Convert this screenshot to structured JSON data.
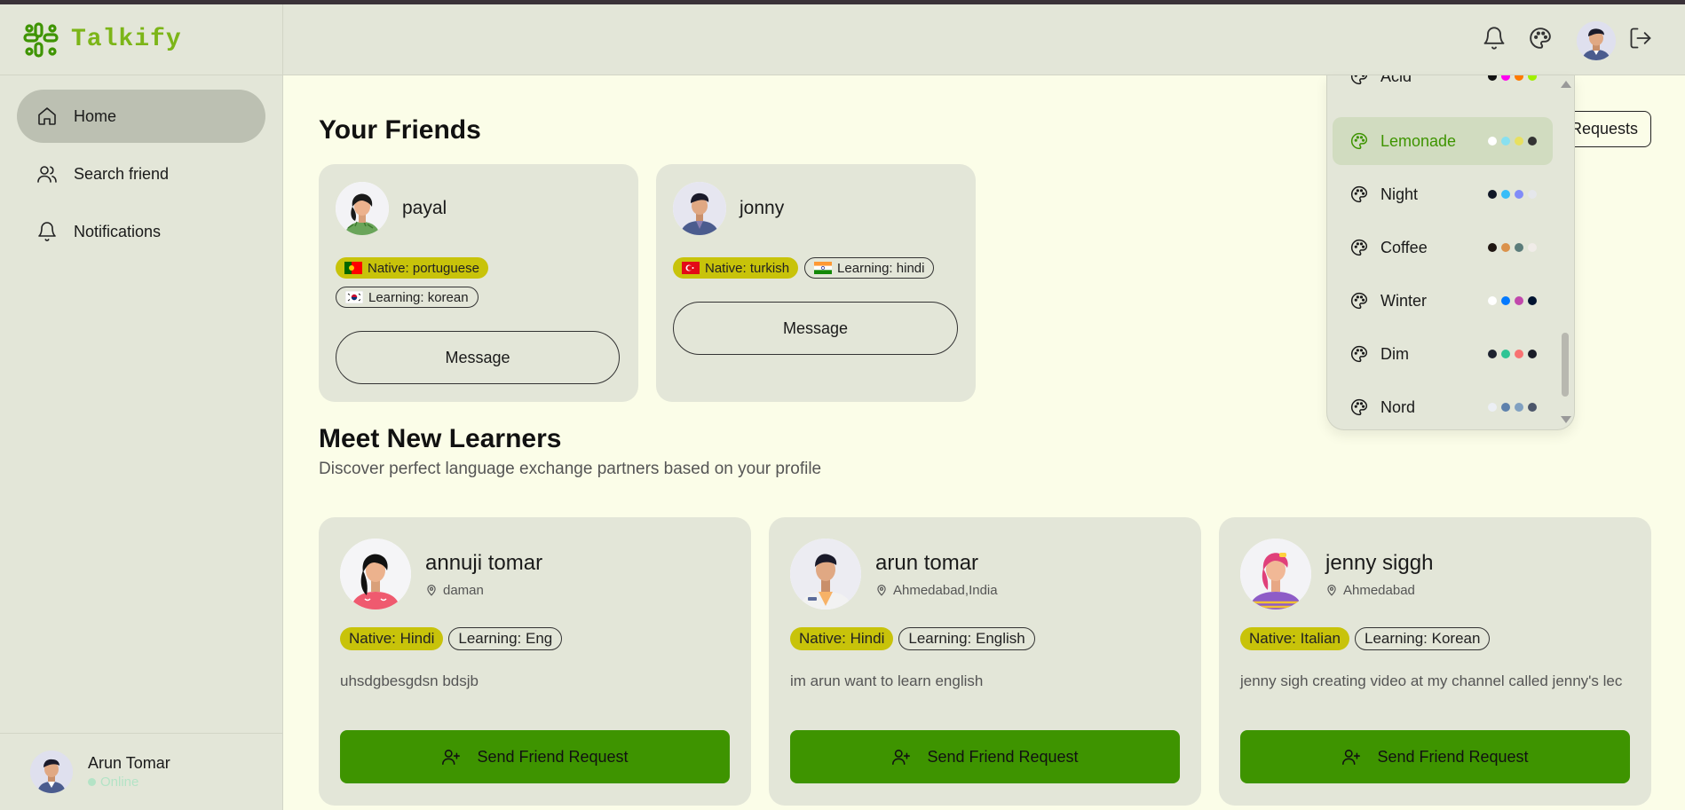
{
  "app": {
    "brand": "Talkify"
  },
  "colors": {
    "brand": "#7cb518",
    "accent_green": "#3e9400",
    "native_chip": "#c8c30a",
    "sidebar_bg": "#e3e6d8",
    "page_bg": "#fbfde8"
  },
  "sidebar": {
    "items": [
      {
        "label": "Home",
        "icon": "home-icon",
        "active": true
      },
      {
        "label": "Search friend",
        "icon": "users-icon",
        "active": false
      },
      {
        "label": "Notifications",
        "icon": "bell-icon",
        "active": false
      }
    ],
    "user": {
      "name": "Arun Tomar",
      "status": "Online"
    }
  },
  "topbar": {
    "icons": [
      "bell-icon",
      "palette-icon",
      "avatar",
      "logout-icon"
    ]
  },
  "friends": {
    "title": "Your Friends",
    "requests_label": "Requests",
    "cards": [
      {
        "name": "payal",
        "native": "Native: portuguese",
        "learning": "Learning: korean",
        "native_flag": "portugal-flag",
        "learning_flag": "korea-flag",
        "button": "Message"
      },
      {
        "name": "jonny",
        "native": "Native: turkish",
        "learning": "Learning: hindi",
        "native_flag": "turkey-flag",
        "learning_flag": "india-flag",
        "button": "Message"
      }
    ]
  },
  "learners": {
    "title": "Meet New Learners",
    "subtitle": "Discover perfect language exchange partners based on your profile",
    "cards": [
      {
        "name": "annuji tomar",
        "location": "daman",
        "native": "Native: Hindi",
        "learning": "Learning: Eng",
        "bio": "uhsdgbesgdsn bdsjb",
        "button": "Send Friend Request"
      },
      {
        "name": "arun tomar",
        "location": "Ahmedabad,India",
        "native": "Native: Hindi",
        "learning": "Learning: English",
        "bio": "im arun want to learn english",
        "button": "Send Friend Request"
      },
      {
        "name": "jenny siggh",
        "location": "Ahmedabad",
        "native": "Native: Italian",
        "learning": "Learning: Korean",
        "bio": "jenny sigh creating video at my channel called jenny's lec",
        "button": "Send Friend Request"
      }
    ]
  },
  "themes": {
    "items": [
      {
        "name": "Acid",
        "active": false,
        "dots": [
          "#111111",
          "#ff00f0",
          "#ff7a00",
          "#a0f000"
        ]
      },
      {
        "name": "Lemonade",
        "active": true,
        "dots": [
          "#ffffff",
          "#88e0f0",
          "#e8e060",
          "#333333"
        ]
      },
      {
        "name": "Night",
        "active": false,
        "dots": [
          "#111827",
          "#38bdf8",
          "#818cf8",
          "#e5e7eb"
        ]
      },
      {
        "name": "Coffee",
        "active": false,
        "dots": [
          "#1f1612",
          "#db924b",
          "#5b7c7a",
          "#f0ece8"
        ]
      },
      {
        "name": "Winter",
        "active": false,
        "dots": [
          "#ffffff",
          "#047aff",
          "#c148ac",
          "#021431"
        ]
      },
      {
        "name": "Dim",
        "active": false,
        "dots": [
          "#1e2330",
          "#2fc495",
          "#f87272",
          "#1a1d28"
        ]
      },
      {
        "name": "Nord",
        "active": false,
        "dots": [
          "#eceff4",
          "#5e81ac",
          "#81a1c1",
          "#4c566a"
        ]
      }
    ]
  }
}
